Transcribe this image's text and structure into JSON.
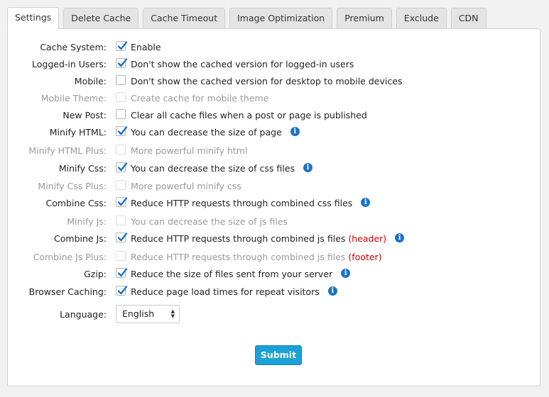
{
  "tabs": [
    "Settings",
    "Delete Cache",
    "Cache Timeout",
    "Image Optimization",
    "Premium",
    "Exclude",
    "CDN"
  ],
  "rows": [
    {
      "label": "Cache System:",
      "checked": true,
      "disabled": false,
      "text": "Enable",
      "extra": "",
      "info": false
    },
    {
      "label": "Logged-in Users:",
      "checked": true,
      "disabled": false,
      "text": "Don't show the cached version for logged-in users",
      "extra": "",
      "info": false
    },
    {
      "label": "Mobile:",
      "checked": false,
      "disabled": false,
      "text": "Don't show the cached version for desktop to mobile devices",
      "extra": "",
      "info": false
    },
    {
      "label": "Mobile Theme:",
      "checked": false,
      "disabled": true,
      "text": "Create cache for mobile theme",
      "extra": "",
      "info": false
    },
    {
      "label": "New Post:",
      "checked": false,
      "disabled": false,
      "text": "Clear all cache files when a post or page is published",
      "extra": "",
      "info": false
    },
    {
      "label": "Minify HTML:",
      "checked": true,
      "disabled": false,
      "text": "You can decrease the size of page",
      "extra": "",
      "info": true
    },
    {
      "label": "Minify HTML Plus:",
      "checked": false,
      "disabled": true,
      "text": "More powerful minify html",
      "extra": "",
      "info": false
    },
    {
      "label": "Minify Css:",
      "checked": true,
      "disabled": false,
      "text": "You can decrease the size of css files",
      "extra": "",
      "info": true
    },
    {
      "label": "Minify Css Plus:",
      "checked": false,
      "disabled": true,
      "text": "More powerful minify css",
      "extra": "",
      "info": false
    },
    {
      "label": "Combine Css:",
      "checked": true,
      "disabled": false,
      "text": "Reduce HTTP requests through combined css files",
      "extra": "",
      "info": true
    },
    {
      "label": "Minify Js:",
      "checked": false,
      "disabled": true,
      "text": "You can decrease the size of js files",
      "extra": "",
      "info": false
    },
    {
      "label": "Combine Js:",
      "checked": true,
      "disabled": false,
      "text": "Reduce HTTP requests through combined js files",
      "extra": "(header)",
      "info": true
    },
    {
      "label": "Combine Js Plus:",
      "checked": false,
      "disabled": true,
      "text": "Reduce HTTP requests through combined js files",
      "extra": "(footer)",
      "info": false
    },
    {
      "label": "Gzip:",
      "checked": true,
      "disabled": false,
      "text": "Reduce the size of files sent from your server",
      "extra": "",
      "info": true
    },
    {
      "label": "Browser Caching:",
      "checked": true,
      "disabled": false,
      "text": "Reduce page load times for repeat visitors",
      "extra": "",
      "info": true
    }
  ],
  "language": {
    "label": "Language:",
    "selected": "English"
  },
  "submit_label": "Submit",
  "info_icon_glyph": "i",
  "colors": {
    "accent": "#1aa2d8",
    "check": "#1a73c9",
    "highlight": "#cc0000"
  }
}
